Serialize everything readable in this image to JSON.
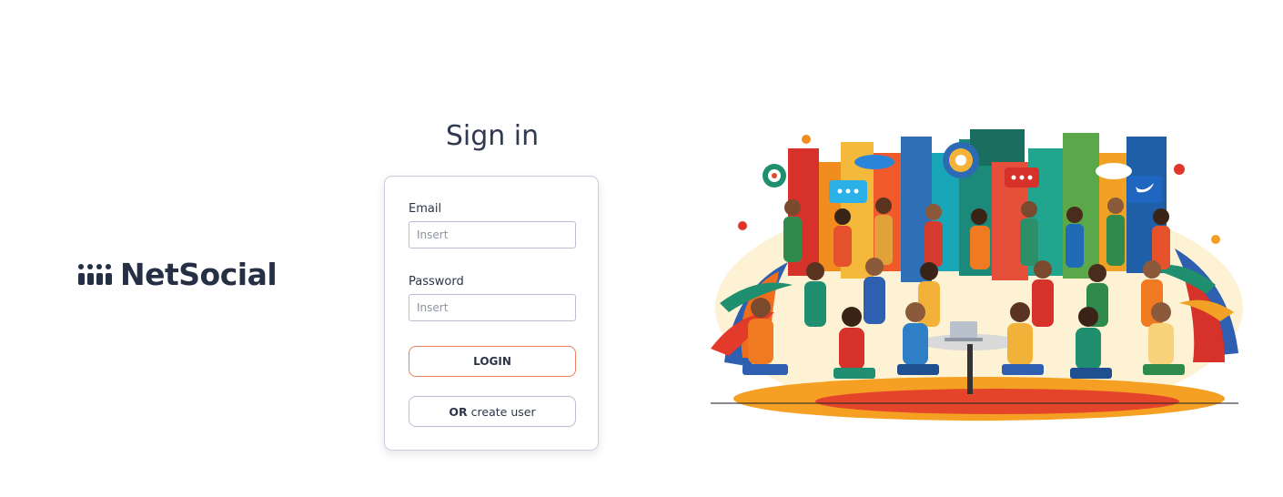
{
  "brand": {
    "name": "NetSocial"
  },
  "signin": {
    "title": "Sign in",
    "email_label": "Email",
    "email_placeholder": "Insert",
    "email_value": "",
    "password_label": "Password",
    "password_placeholder": "Insert",
    "password_value": "",
    "login_label": "LOGIN",
    "create_prefix": "OR",
    "create_label": "create user"
  },
  "colors": {
    "text_dark": "#253045",
    "login_border": "#e9805f",
    "card_border": "#c9cedc"
  }
}
